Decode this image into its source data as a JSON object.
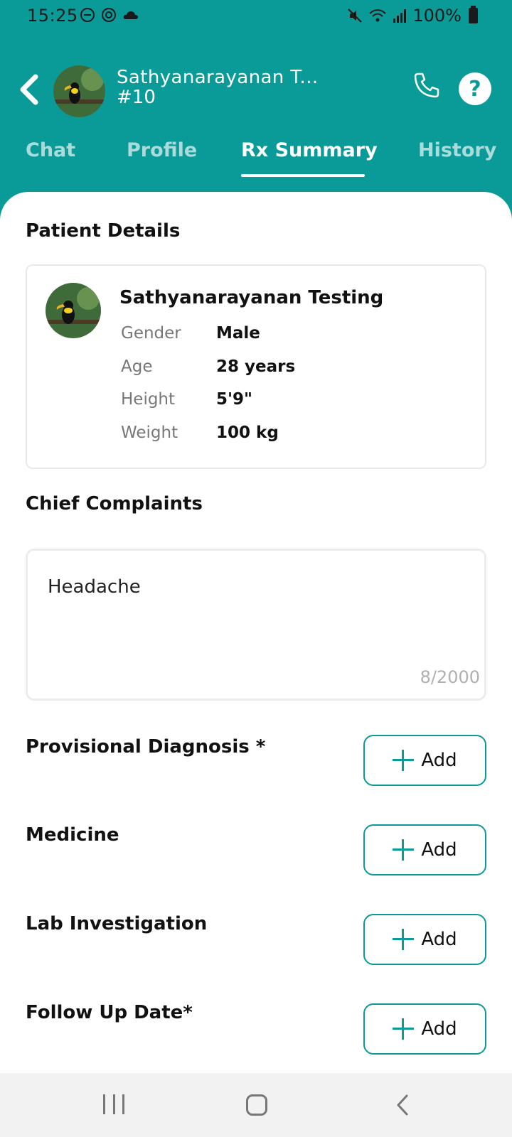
{
  "status_bar": {
    "time": "15:25",
    "battery": "100%",
    "left_icons": [
      "do-not-disturb-icon",
      "sync-icon",
      "cloud-icon"
    ],
    "right_icons": [
      "mute-icon",
      "wifi-icon",
      "signal-icon",
      "battery-icon"
    ]
  },
  "header": {
    "name": "Sathyanarayanan T...",
    "sub": "#10"
  },
  "tabs": [
    {
      "label": "Chat",
      "active": false
    },
    {
      "label": "Profile",
      "active": false
    },
    {
      "label": "Rx Summary",
      "active": true
    },
    {
      "label": "History",
      "active": false
    }
  ],
  "patient": {
    "section_title": "Patient Details",
    "name": "Sathyanarayanan Testing",
    "fields": [
      {
        "label": "Gender",
        "value": "Male"
      },
      {
        "label": "Age",
        "value": "28 years"
      },
      {
        "label": "Height",
        "value": "5'9\""
      },
      {
        "label": "Weight",
        "value": "100 kg"
      }
    ]
  },
  "complaints": {
    "section_title": "Chief Complaints",
    "text": "Headache",
    "counter": "8/2000"
  },
  "rx_sections": [
    {
      "label": "Provisional Diagnosis *",
      "button": "Add"
    },
    {
      "label": "Medicine",
      "button": "Add"
    },
    {
      "label": "Lab Investigation",
      "button": "Add"
    },
    {
      "label": "Follow Up Date*",
      "button": "Add"
    }
  ],
  "colors": {
    "primary": "#0a9a98",
    "background": "#ffffff"
  }
}
